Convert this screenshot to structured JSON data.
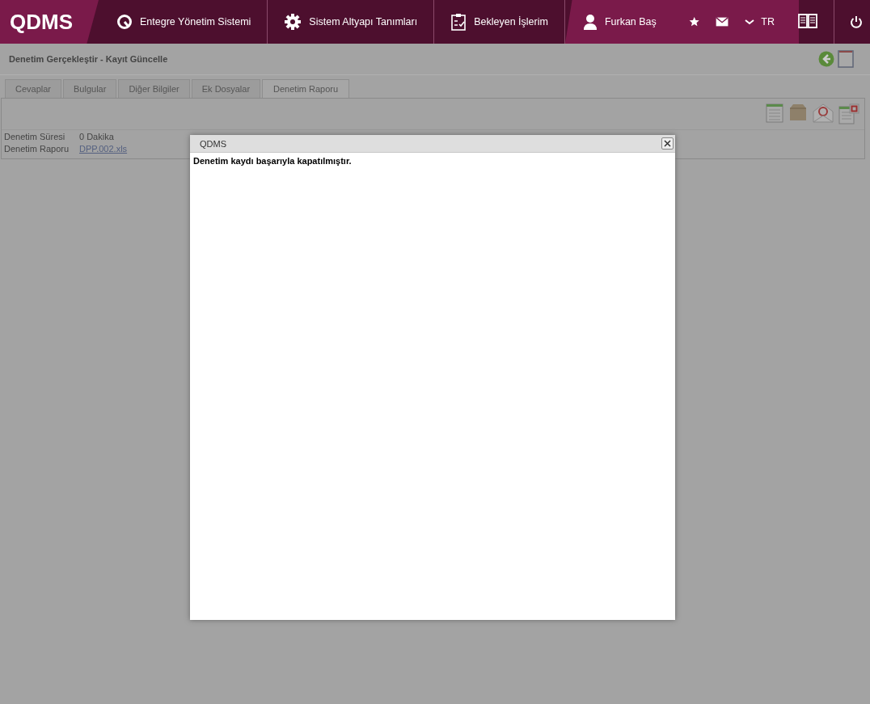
{
  "header": {
    "logo": "QDMS",
    "nav": [
      {
        "kind": "system",
        "label": "Entegre Yönetim Sistemi"
      },
      {
        "kind": "settings",
        "label": "Sistem Altyapı Tanımları"
      },
      {
        "kind": "tasks",
        "label": "Bekleyen İşlerim"
      }
    ],
    "user": "Furkan Baş",
    "language": "TR"
  },
  "page": {
    "title": "Denetim Gerçekleştir - Kayıt Güncelle",
    "tabs": [
      {
        "label": "Cevaplar",
        "selected": false
      },
      {
        "label": "Bulgular",
        "selected": false
      },
      {
        "label": "Diğer Bilgiler",
        "selected": false
      },
      {
        "label": "Ek Dosyalar",
        "selected": false
      },
      {
        "label": "Denetim Raporu",
        "selected": true
      }
    ],
    "fields": [
      {
        "label": "Denetim Süresi",
        "value": "0 Dakika",
        "kind": "text"
      },
      {
        "label": "Denetim Raporu",
        "value": "DPP.002.xls",
        "kind": "link"
      }
    ]
  },
  "dialog": {
    "title": "QDMS",
    "message": "Denetim kaydı başarıyla kapatılmıştır."
  }
}
